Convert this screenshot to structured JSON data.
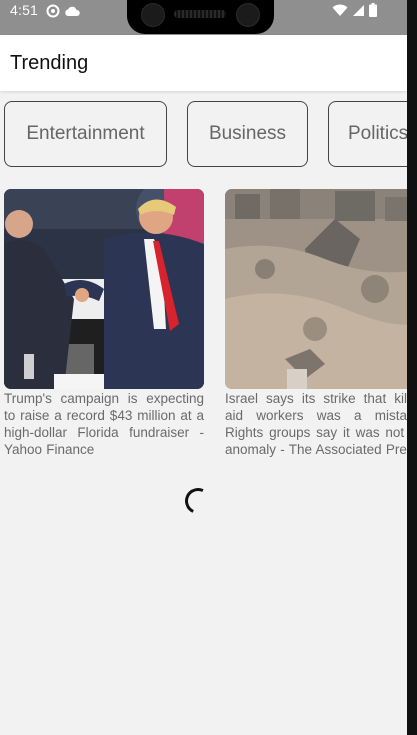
{
  "status_bar": {
    "time": "4:51",
    "left_icons": [
      "status-settings-icon",
      "cloud-icon"
    ],
    "right_icons": [
      "wifi-icon",
      "signal-icon",
      "battery-icon"
    ]
  },
  "appbar": {
    "title": "Trending"
  },
  "categories": [
    "Entertainment",
    "Business",
    "Politics"
  ],
  "articles": [
    {
      "image_icon": "trump-handshake-photo",
      "headline": "Trump's campaign is expecting to raise a record $43 million at a high-dollar Florida fundraiser - Yahoo Finance"
    },
    {
      "image_icon": "gaza-rubble-photo",
      "headline": "Israel says its strike that killed aid workers was a mistake. Rights groups say it was not an anomaly - The Associated Press"
    }
  ],
  "loading": {
    "icon": "loading-spinner-icon"
  }
}
